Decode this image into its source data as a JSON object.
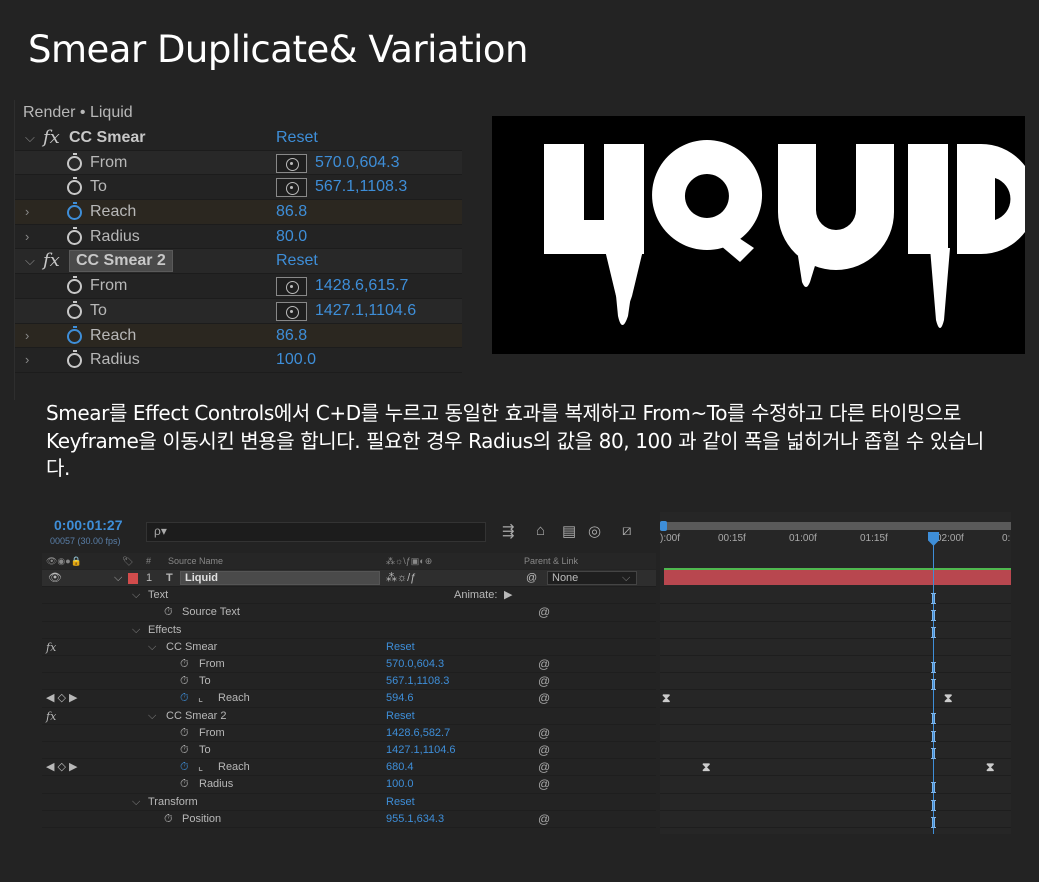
{
  "page": {
    "title": "Smear Duplicate& Variation",
    "description": "Smear를 Effect Controls에서 C+D를 누르고 동일한 효과를 복제하고 From~To를 수정하고 다른 타이밍으로 Keyframe을 이동시킨 변용을 합니다.  필요한 경우 Radius의 값을 80, 100 과 같이 폭을 넓히거나 좁힐 수 있습니다."
  },
  "effect_controls": {
    "header": "Render • Liquid",
    "effects": [
      {
        "name": "CC Smear",
        "reset": "Reset",
        "params": [
          {
            "name": "From",
            "value": "570.0,604.3"
          },
          {
            "name": "To",
            "value": "567.1,1108.3"
          },
          {
            "name": "Reach",
            "value": "86.8"
          },
          {
            "name": "Radius",
            "value": "80.0"
          }
        ]
      },
      {
        "name": "CC Smear 2",
        "reset": "Reset",
        "params": [
          {
            "name": "From",
            "value": "1428.6,615.7"
          },
          {
            "name": "To",
            "value": "1427.1,1104.6"
          },
          {
            "name": "Reach",
            "value": "86.8"
          },
          {
            "name": "Radius",
            "value": "100.0"
          }
        ]
      }
    ]
  },
  "preview": {
    "text": "LIQUID",
    "background": "#000000",
    "text_color": "#ffffff"
  },
  "timeline": {
    "timecode": "0:00:01:27",
    "frame_info": "00057 (30.00 fps)",
    "search_placeholder": "ρ▾",
    "columns": {
      "num": "#",
      "source": "Source Name",
      "parent": "Parent & Link"
    },
    "layer": {
      "index": "1",
      "type": "T",
      "name": "Liquid",
      "parent": "None",
      "color": "#d24c4c"
    },
    "rows": {
      "text": "Text",
      "animate": "Animate:",
      "source_text": "Source Text",
      "effects": "Effects",
      "fx1": "CC Smear",
      "fx1_reset": "Reset",
      "fx1_from": "From",
      "fx1_from_val": "570.0,604.3",
      "fx1_to": "To",
      "fx1_to_val": "567.1,1108.3",
      "fx1_reach": "Reach",
      "fx1_reach_val": "594.6",
      "fx2": "CC Smear 2",
      "fx2_reset": "Reset",
      "fx2_from": "From",
      "fx2_from_val": "1428.6,582.7",
      "fx2_to": "To",
      "fx2_to_val": "1427.1,1104.6",
      "fx2_reach": "Reach",
      "fx2_reach_val": "680.4",
      "fx2_radius": "Radius",
      "fx2_radius_val": "100.0",
      "transform": "Transform",
      "transform_reset": "Reset",
      "position": "Position",
      "position_val": "955.1,634.3"
    },
    "ruler_ticks": [
      "):00f",
      "00:15f",
      "01:00f",
      "01:15f",
      "02:00f",
      "0:"
    ],
    "accent": "#3e8ed8",
    "label_fx": "fx"
  }
}
